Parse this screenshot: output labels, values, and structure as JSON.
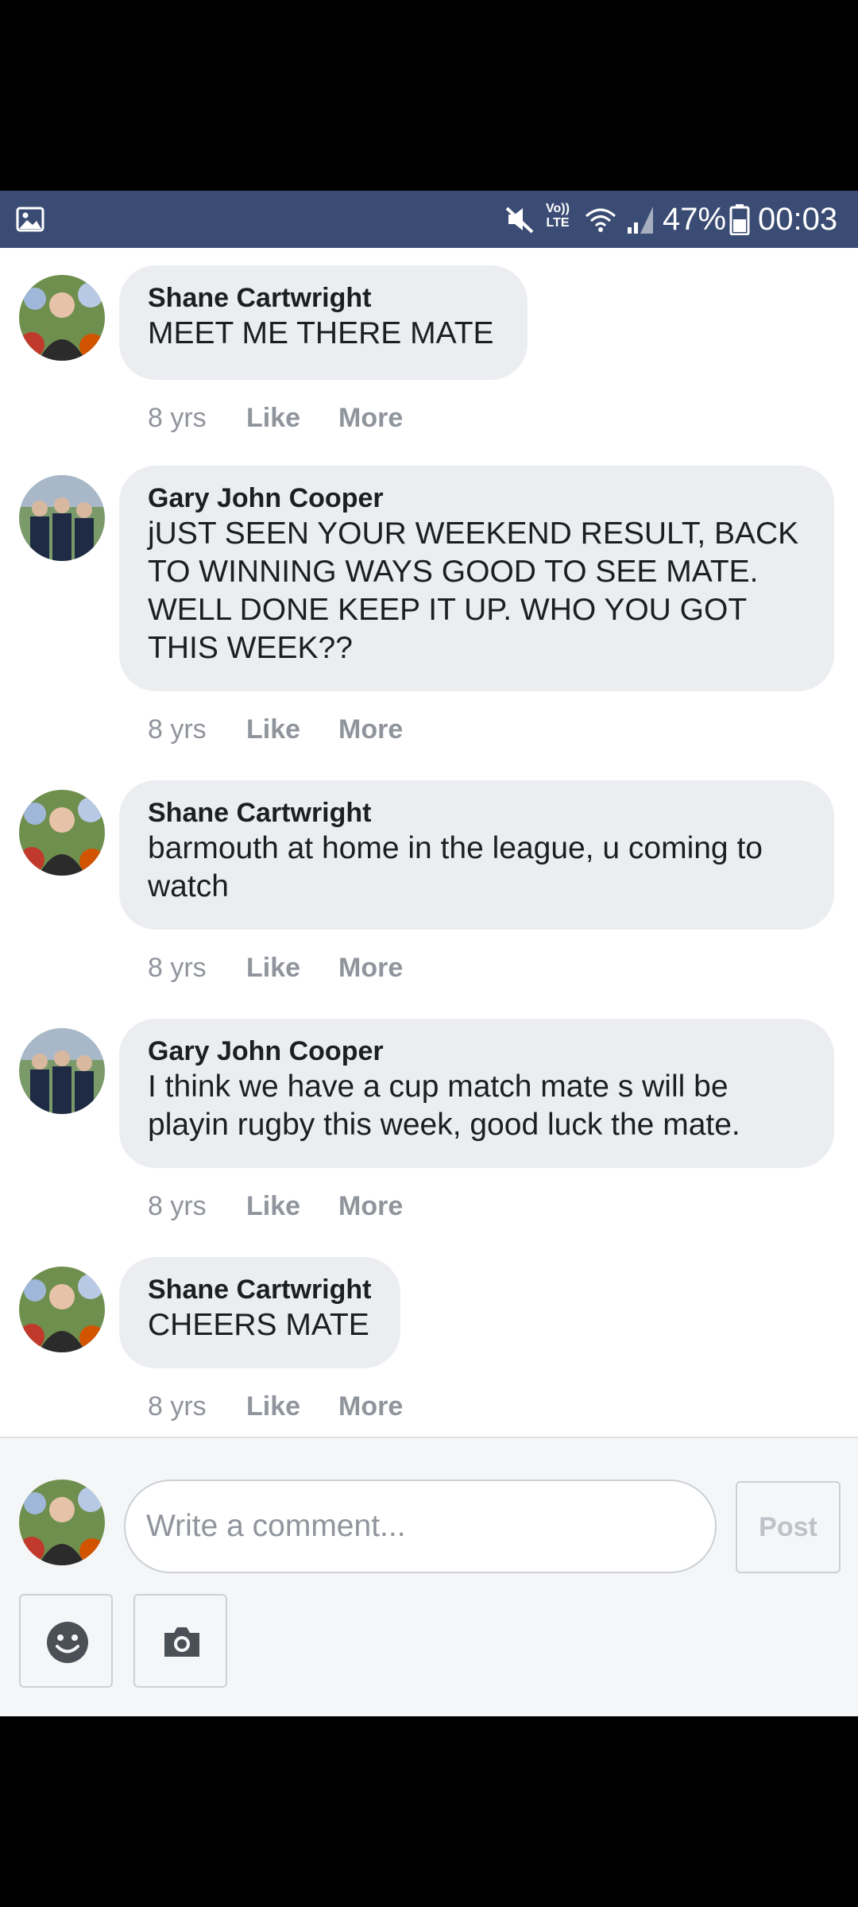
{
  "status_bar": {
    "network": "Vo)) LTE",
    "battery_percent": "47%",
    "time": "00:03",
    "icons": [
      "gallery-icon",
      "mute-icon",
      "wifi-icon",
      "signal-icon",
      "battery-icon"
    ]
  },
  "comments": [
    {
      "author": "Shane Cartwright",
      "text": "MEET ME THERE MATE",
      "time": "8 yrs",
      "like": "Like",
      "more": "More"
    },
    {
      "author": "Gary John Cooper",
      "text": "jUST SEEN YOUR WEEKEND RESULT, BACK TO WINNING WAYS GOOD TO SEE MATE. WELL DONE KEEP IT UP. WHO YOU GOT THIS WEEK??",
      "time": "8 yrs",
      "like": "Like",
      "more": "More"
    },
    {
      "author": "Shane Cartwright",
      "text": "barmouth at home in the league, u coming to watch",
      "time": "8 yrs",
      "like": "Like",
      "more": "More"
    },
    {
      "author": "Gary John Cooper",
      "text": "I think we have a cup match mate s will be playin rugby this week, good luck the mate.",
      "time": "8 yrs",
      "like": "Like",
      "more": "More"
    },
    {
      "author": "Shane Cartwright",
      "text": "CHEERS MATE",
      "time": "8 yrs",
      "like": "Like",
      "more": "More"
    }
  ],
  "composer": {
    "placeholder": "Write a comment...",
    "post_label": "Post",
    "icons": [
      "emoji-icon",
      "camera-icon"
    ]
  },
  "colors": {
    "status_bar": "#3b4c74",
    "bubble": "#ebedf0",
    "meta_text": "#90949c",
    "composer_bg": "#f5f6f7"
  }
}
